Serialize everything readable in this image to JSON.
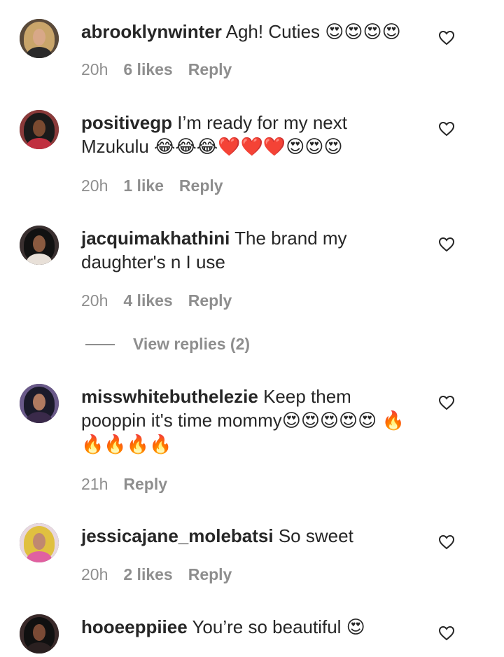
{
  "comments": [
    {
      "username": "abrooklynwinter",
      "text": "Agh! Cuties 😍😍😍😍",
      "time": "20h",
      "likes": "6 likes",
      "reply": "Reply",
      "avatar_colors": {
        "bg": "#5a4a3a",
        "hair": "#c9a56a",
        "face": "#d8a888",
        "body": "#2a2a2a"
      }
    },
    {
      "username": "positivegp",
      "text": "I’m ready for my next Mzukulu 😂😂😂❤️❤️❤️😍😍😍",
      "time": "20h",
      "likes": "1 like",
      "reply": "Reply",
      "avatar_colors": {
        "bg": "#8a3a3a",
        "hair": "#1a1a1a",
        "face": "#7a4a30",
        "body": "#c03040"
      }
    },
    {
      "username": "jacquimakhathini",
      "text": "The brand my daughter's n I use",
      "time": "20h",
      "likes": "4 likes",
      "reply": "Reply",
      "avatar_colors": {
        "bg": "#3a3030",
        "hair": "#111111",
        "face": "#8a5a40",
        "body": "#e8e0d8"
      }
    },
    {
      "username": "misswhitebuthelezie",
      "text": "Keep them pooppin it's time mommy😍😍😍😍😍 🔥🔥🔥🔥🔥",
      "time": "21h",
      "likes": "",
      "reply": "Reply",
      "avatar_colors": {
        "bg": "#6a5a8a",
        "hair": "#1a1a2a",
        "face": "#b07a60",
        "body": "#3a2a4a"
      }
    },
    {
      "username": "jessicajane_molebatsi",
      "text": "So sweet",
      "time": "20h",
      "likes": "2 likes",
      "reply": "Reply",
      "avatar_colors": {
        "bg": "#e8d8e0",
        "hair": "#e0c040",
        "face": "#c08870",
        "body": "#e060a0"
      }
    },
    {
      "username": "hooeeppiiee",
      "text": "You’re so beautiful 😍",
      "time": "",
      "likes": "",
      "reply": "",
      "avatar_colors": {
        "bg": "#3a2a2a",
        "hair": "#101010",
        "face": "#7a4a35",
        "body": "#2a2020"
      }
    }
  ],
  "view_replies": "View replies (2)"
}
